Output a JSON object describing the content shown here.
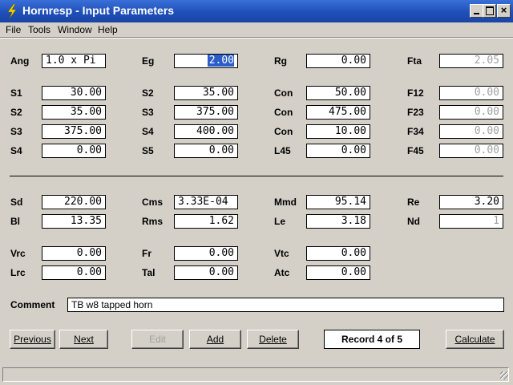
{
  "window": {
    "title": "Hornresp - Input Parameters"
  },
  "menu": [
    "File",
    "Tools",
    "Window",
    "Help"
  ],
  "rows": [
    [
      {
        "label": "Ang",
        "value": "1.0 x Pi",
        "align": "left"
      },
      {
        "label": "Eg",
        "value": "2.00",
        "state": "selected"
      },
      {
        "label": "Rg",
        "value": "0.00"
      },
      {
        "label": "Fta",
        "value": "2.05",
        "state": "disabled"
      }
    ],
    [
      {
        "label": "S1",
        "value": "30.00"
      },
      {
        "label": "S2",
        "value": "35.00"
      },
      {
        "label": "Con",
        "value": "50.00"
      },
      {
        "label": "F12",
        "value": "0.00",
        "state": "disabled"
      }
    ],
    [
      {
        "label": "S2",
        "value": "35.00"
      },
      {
        "label": "S3",
        "value": "375.00"
      },
      {
        "label": "Con",
        "value": "475.00"
      },
      {
        "label": "F23",
        "value": "0.00",
        "state": "disabled"
      }
    ],
    [
      {
        "label": "S3",
        "value": "375.00"
      },
      {
        "label": "S4",
        "value": "400.00"
      },
      {
        "label": "Con",
        "value": "10.00"
      },
      {
        "label": "F34",
        "value": "0.00",
        "state": "disabled"
      }
    ],
    [
      {
        "label": "S4",
        "value": "0.00"
      },
      {
        "label": "S5",
        "value": "0.00"
      },
      {
        "label": "L45",
        "value": "0.00"
      },
      {
        "label": "F45",
        "value": "0.00",
        "state": "disabled"
      }
    ],
    [
      {
        "label": "Sd",
        "value": "220.00"
      },
      {
        "label": "Cms",
        "value": "3.33E-04",
        "align": "left"
      },
      {
        "label": "Mmd",
        "value": "95.14"
      },
      {
        "label": "Re",
        "value": "3.20"
      }
    ],
    [
      {
        "label": "Bl",
        "value": "13.35"
      },
      {
        "label": "Rms",
        "value": "1.62"
      },
      {
        "label": "Le",
        "value": "3.18"
      },
      {
        "label": "Nd",
        "value": "1",
        "state": "disabled"
      }
    ],
    [
      {
        "label": "Vrc",
        "value": "0.00"
      },
      {
        "label": "Fr",
        "value": "0.00"
      },
      {
        "label": "Vtc",
        "value": "0.00"
      }
    ],
    [
      {
        "label": "Lrc",
        "value": "0.00"
      },
      {
        "label": "Tal",
        "value": "0.00"
      },
      {
        "label": "Atc",
        "value": "0.00"
      }
    ]
  ],
  "comment": {
    "label": "Comment",
    "value": "TB w8 tapped horn"
  },
  "buttons": {
    "previous": "Previous",
    "next": "Next",
    "edit": "Edit",
    "add": "Add",
    "delete": "Delete",
    "record": "Record 4 of 5",
    "calculate": "Calculate"
  },
  "colors": {
    "title_bar": "#1f4fb8",
    "selection": "#2b5dc9",
    "disabled_text": "#a0a0a0",
    "face": "#d4d0c8"
  }
}
